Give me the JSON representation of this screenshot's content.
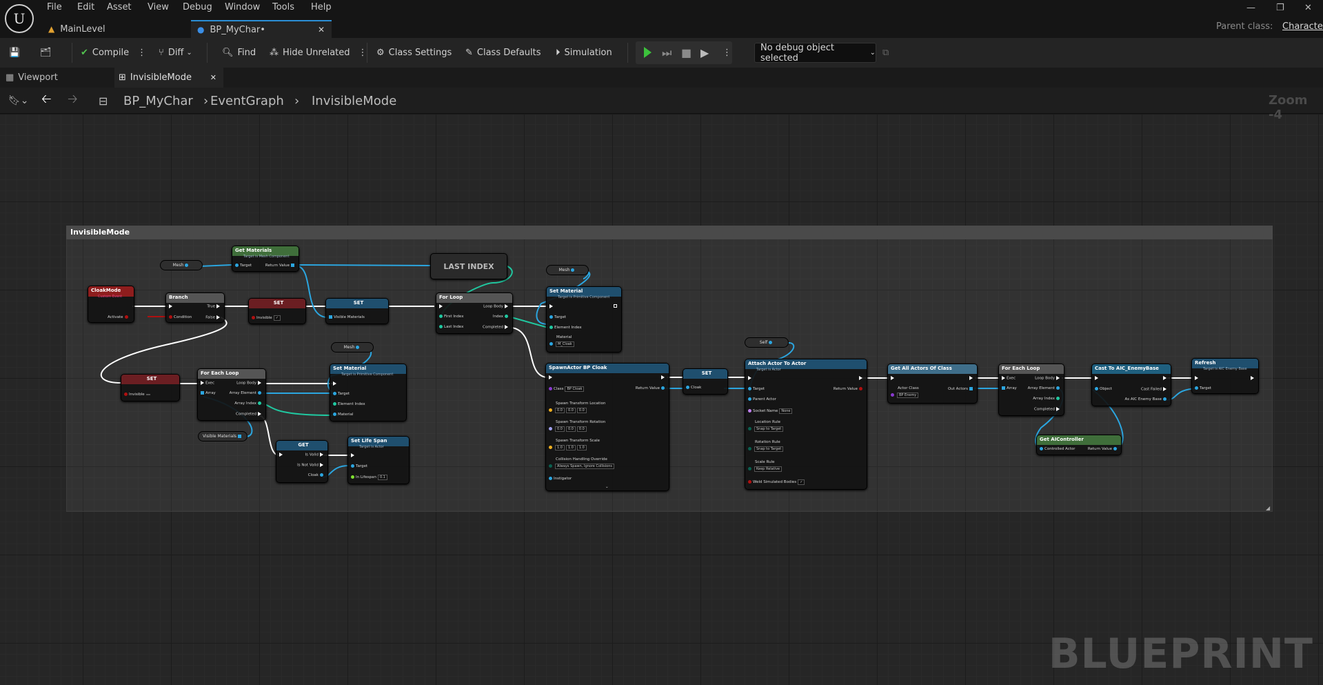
{
  "menu": [
    "File",
    "Edit",
    "Asset",
    "View",
    "Debug",
    "Window",
    "Tools",
    "Help"
  ],
  "tabs": {
    "level": "MainLevel",
    "blueprint": "BP_MyChar•"
  },
  "parent": {
    "label": "Parent class:",
    "value": "Character"
  },
  "toolbar": {
    "compile": "Compile",
    "diff": "Diff",
    "find": "Find",
    "hide_unrelated": "Hide Unrelated",
    "class_settings": "Class Settings",
    "class_defaults": "Class Defaults",
    "simulation": "Simulation",
    "debug_object": "No debug object selected"
  },
  "subtabs": {
    "viewport": "Viewport",
    "graph": "InvisibleMode"
  },
  "breadcrumb": [
    "BP_MyChar",
    "EventGraph",
    "InvisibleMode"
  ],
  "zoom": "Zoom -4",
  "comment": "InvisibleMode",
  "watermark": "BLUEPRINT",
  "nodes": {
    "mesh1": "Mesh",
    "get_materials": "Get Materials",
    "get_materials_sub": "Target is Mesh Component",
    "target": "Target",
    "return_value": "Return Value",
    "last_index": "LAST INDEX",
    "cloakmode": "CloakMode",
    "custom_event": "Custom Event",
    "activate": "Activate",
    "branch": "Branch",
    "condition": "Condition",
    "true": "True",
    "false": "False",
    "set": "SET",
    "invisible": "Invisible",
    "visible_materials": "Visible Materials",
    "for_loop": "For Loop",
    "first_index": "First Index",
    "last_index_pin": "Last Index",
    "loop_body": "Loop Body",
    "index": "Index",
    "completed": "Completed",
    "mesh2": "Mesh",
    "set_material": "Set Material",
    "set_material_sub": "Target is Primitive Component",
    "element_index": "Element Index",
    "material": "Material",
    "material_val": "M_Cloak",
    "for_each_loop": "For Each Loop",
    "exec": "Exec",
    "array": "Array",
    "array_element": "Array Element",
    "array_index": "Array Index",
    "mesh3": "Mesh",
    "visible_materials_var": "Visible Materials",
    "get": "GET",
    "is_valid": "Is Valid",
    "is_not_valid": "Is Not Valid",
    "cloak": "Cloak",
    "set_life_span": "Set Life Span",
    "set_life_span_sub": "Target is Actor",
    "in_lifespan": "In Lifespan",
    "in_lifespan_val": "0.1",
    "spawn": "SpawnActor BP Cloak",
    "class": "Class",
    "class_val": "BP Cloak",
    "spawn_loc": "Spawn Transform Location",
    "spawn_rot": "Spawn Transform Rotation",
    "spawn_scale": "Spawn Transform Scale",
    "collision": "Collision Handling Override",
    "collision_val": "Always Spawn, Ignore Collisions",
    "instigator": "Instigator",
    "loc_vals": [
      "0.0",
      "0.0",
      "0.0"
    ],
    "rot_vals": [
      "0.0",
      "0.0",
      "0.0"
    ],
    "scale_vals": [
      "1.0",
      "1.0",
      "1.0"
    ],
    "self": "Self",
    "attach": "Attach Actor To Actor",
    "attach_sub": "Target is Actor",
    "parent_actor": "Parent Actor",
    "socket_name": "Socket Name",
    "socket_val": "None",
    "location_rule": "Location Rule",
    "rotation_rule": "Rotation Rule",
    "scale_rule": "Scale Rule",
    "snap": "Snap to Target",
    "keep_relative": "Keep Relative",
    "weld": "Weld Simulated Bodies",
    "get_all": "Get All Actors Of Class",
    "actor_class": "Actor Class",
    "actor_class_val": "BP Enemy",
    "out_actors": "Out Actors",
    "for_each_loop2": "For Each Loop",
    "cast": "Cast To AIC_EnemyBase",
    "object": "Object",
    "cast_failed": "Cast Failed",
    "as_aic": "As AIC Enemy Base",
    "get_aicontroller": "Get AIController",
    "controlled_actor": "Controlled Actor",
    "refresh": "Refresh",
    "refresh_sub": "Target is AIC Enemy Base"
  }
}
